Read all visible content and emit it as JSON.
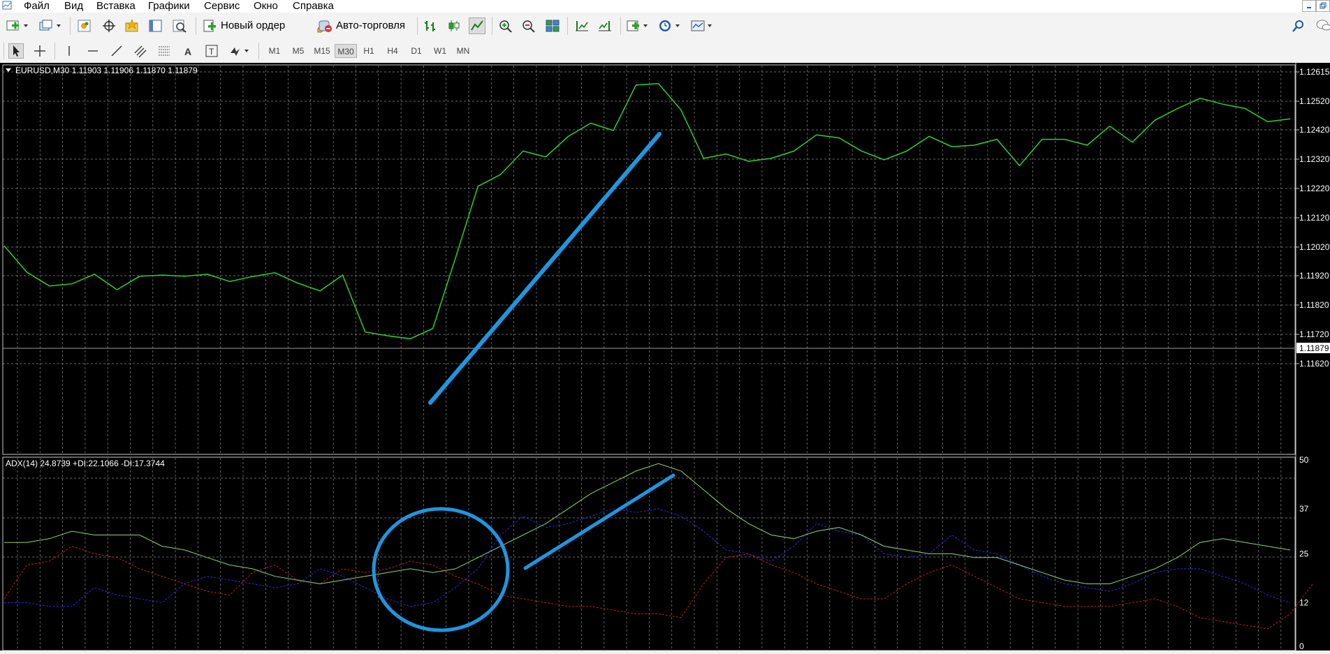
{
  "menu": [
    "Файл",
    "Вид",
    "Вставка",
    "Графики",
    "Сервис",
    "Окно",
    "Справка"
  ],
  "toolbar": {
    "new_order_label": "Новый ордер",
    "autotrading_label": "Авто-торговля"
  },
  "timeframes": [
    "M1",
    "M5",
    "M15",
    "M30",
    "H1",
    "H4",
    "D1",
    "W1",
    "MN"
  ],
  "active_timeframe": "M30",
  "price_chart": {
    "header": "EURUSD,M30  1.11903 1.11906 1.11870 1.11879",
    "price_labels": [
      "1.12615",
      "1.12520",
      "1.12420",
      "1.12320",
      "1.12220",
      "1.12120",
      "1.12020",
      "1.11920",
      "1.11820",
      "1.11720",
      "1.11620"
    ],
    "current_price": "1.11879",
    "line_color": "#32cd32"
  },
  "indicator": {
    "header": "ADX(14) 24.8739 +DI:22.1066 -DI:17.3744",
    "levels": [
      "50",
      "37",
      "25",
      "12",
      "0"
    ],
    "adx_color": "#8fd37a",
    "plus_di_color": "#2a2ad2",
    "minus_di_color": "#b22222"
  },
  "annotations_color": "#1e96e0"
}
